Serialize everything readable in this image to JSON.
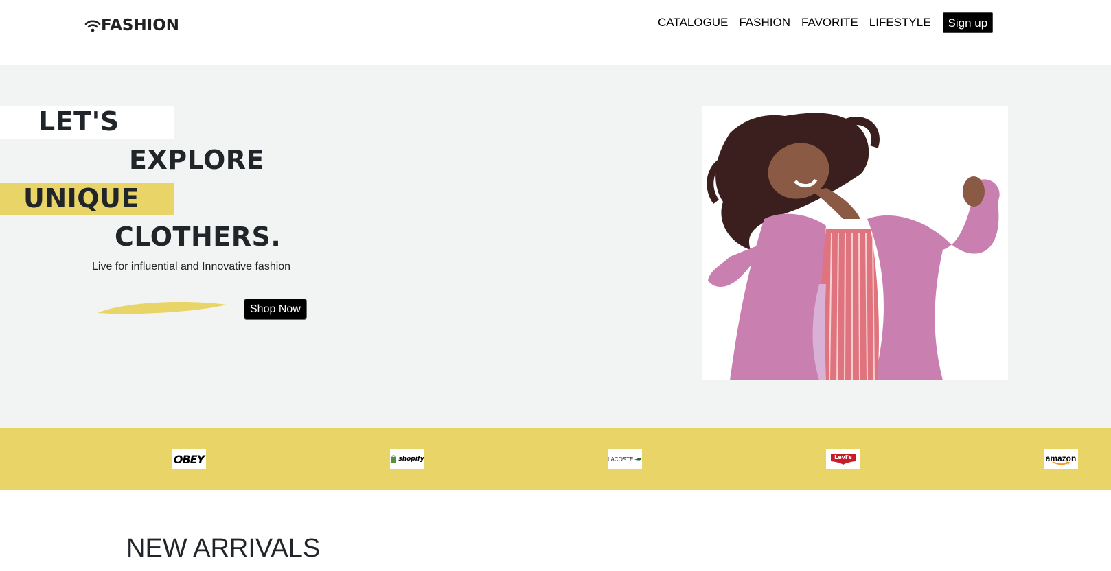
{
  "header": {
    "logo_text": "FASHION",
    "logo_icon": "wifi-icon",
    "nav": [
      {
        "label": "CATALOGUE"
      },
      {
        "label": "FASHION"
      },
      {
        "label": "FAVORITE"
      },
      {
        "label": "LIFESTYLE"
      }
    ],
    "signup_label": "Sign up"
  },
  "hero": {
    "lines": [
      "LET'S",
      "EXPLORE",
      "UNIQUE",
      "CLOTHERS."
    ],
    "tagline": "Live for influential and Innovative fashion",
    "shop_label": "Shop Now",
    "accent_color": "#e9d567",
    "background_color": "#f2f4f3"
  },
  "brands": [
    {
      "name": "OBEY"
    },
    {
      "name": "shopify"
    },
    {
      "name": "LACOSTE"
    },
    {
      "name": "Levi's"
    },
    {
      "name": "amazon"
    }
  ],
  "arrivals": {
    "title": "NEW ARRIVALS"
  }
}
